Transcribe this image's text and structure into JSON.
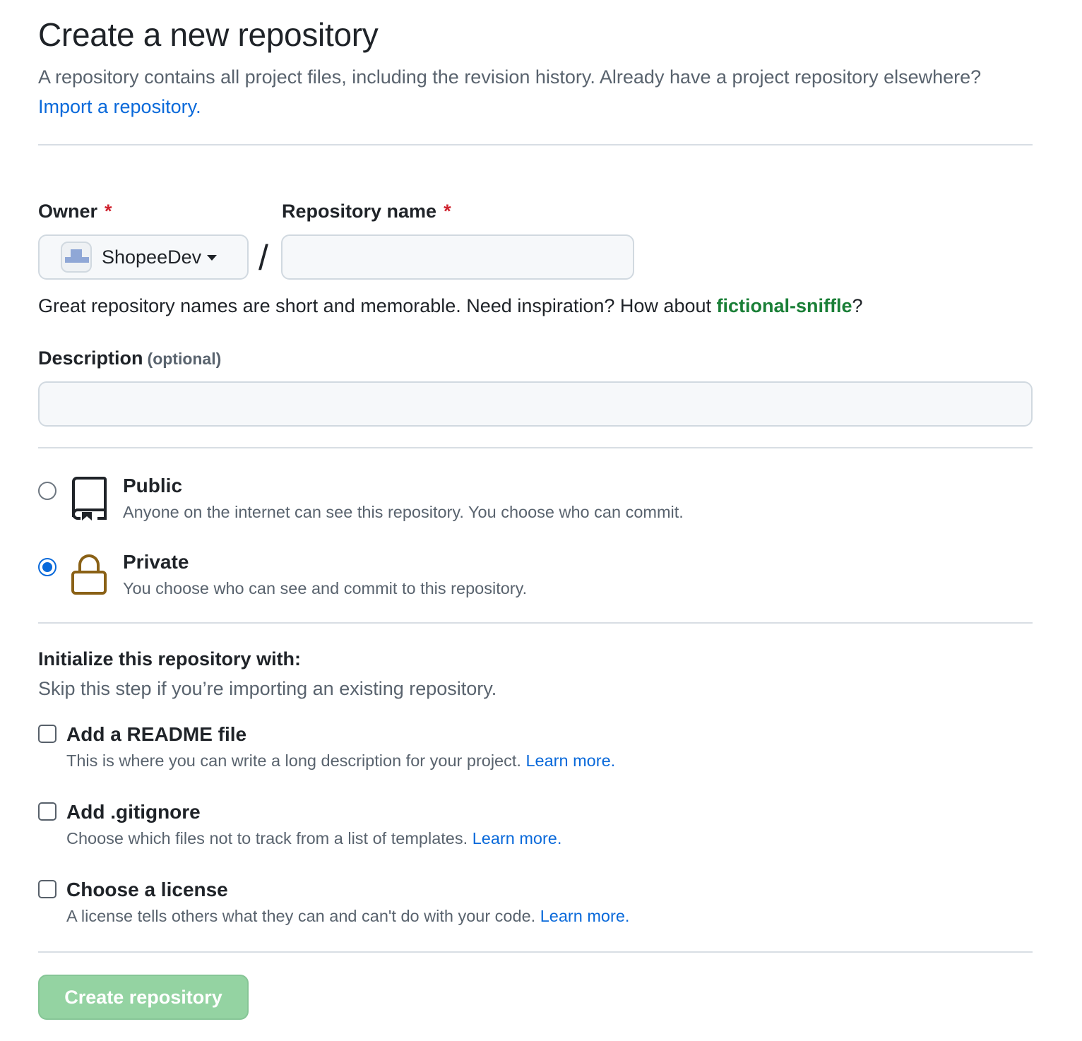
{
  "header": {
    "title": "Create a new repository",
    "subtitle_text": "A repository contains all project files, including the revision history. Already have a project repository elsewhere?",
    "import_link": "Import a repository."
  },
  "owner": {
    "label": "Owner",
    "required_mark": "*",
    "value": "ShopeeDev"
  },
  "separator": "/",
  "repo_name": {
    "label": "Repository name",
    "required_mark": "*",
    "value": "",
    "hint_prefix": "Great repository names are short and memorable. Need inspiration? How about",
    "suggestion": "fictional-sniffle",
    "hint_suffix": "?"
  },
  "description": {
    "label": "Description",
    "optional": "(optional)",
    "value": ""
  },
  "visibility": {
    "public": {
      "title": "Public",
      "desc": "Anyone on the internet can see this repository. You choose who can commit.",
      "checked": false
    },
    "private": {
      "title": "Private",
      "desc": "You choose who can see and commit to this repository.",
      "checked": true
    }
  },
  "initialize": {
    "title": "Initialize this repository with:",
    "subtitle": "Skip this step if you’re importing an existing repository.",
    "options": [
      {
        "title": "Add a README file",
        "desc": "This is where you can write a long description for your project.",
        "link": "Learn more."
      },
      {
        "title": "Add .gitignore",
        "desc": "Choose which files not to track from a list of templates.",
        "link": "Learn more."
      },
      {
        "title": "Choose a license",
        "desc": "A license tells others what they can and can't do with your code.",
        "link": "Learn more."
      }
    ]
  },
  "submit": {
    "label": "Create repository"
  },
  "colors": {
    "link": "#0969da",
    "suggestion": "#1a7f37",
    "required": "#cf222e",
    "lock_icon": "#8a6116",
    "button_disabled": "#94d3a2"
  },
  "icons": {
    "public": "repo-book-icon",
    "private": "lock-icon",
    "owner_menu": "caret-down-icon"
  }
}
